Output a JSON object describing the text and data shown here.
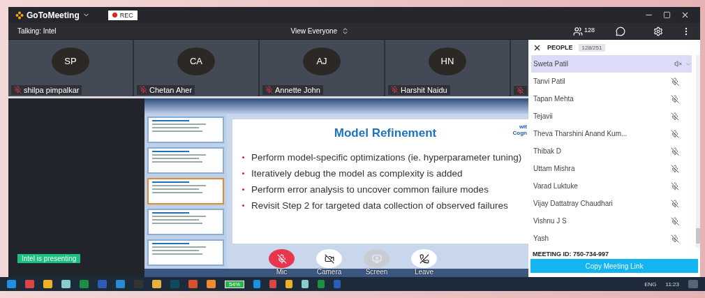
{
  "window": {
    "app_name": "GoToMeeting",
    "recording_label": "REC"
  },
  "toolbar": {
    "talking": "Talking: Intel",
    "view": "View Everyone",
    "people_count": "128"
  },
  "tiles": [
    {
      "initials": "SP",
      "name": "shilpa pimpalkar",
      "muted": true
    },
    {
      "initials": "CA",
      "name": "Chetan Aher",
      "muted": true
    },
    {
      "initials": "AJ",
      "name": "Annette John",
      "muted": true
    },
    {
      "initials": "HN",
      "name": "Harshit Naidu",
      "muted": true
    },
    {
      "muted": true
    }
  ],
  "presentation": {
    "presenter_badge": "Intel is presenting",
    "thumbnails": [
      {
        "selected": false
      },
      {
        "selected": false
      },
      {
        "selected": true
      },
      {
        "selected": false
      },
      {
        "selected": false
      }
    ],
    "slide": {
      "title": "Model Refinement",
      "logo_text": [
        "wit",
        "Cogn"
      ],
      "bullets": [
        "Perform model-specific optimizations (ie. hyperparameter tuning)",
        "Iteratively debug the model as complexity is added",
        "Perform error analysis to uncover common failure modes",
        "Revisit Step 2 for targeted data collection of observed failures"
      ]
    }
  },
  "controls": [
    {
      "label": "Mic",
      "kind": "mic",
      "on": false,
      "disabled": false
    },
    {
      "label": "Camera",
      "kind": "camera",
      "on": false,
      "disabled": false
    },
    {
      "label": "Screen",
      "kind": "screen",
      "on": false,
      "disabled": true
    },
    {
      "label": "Leave",
      "kind": "leave",
      "disabled": false
    }
  ],
  "people": {
    "title": "PEOPLE",
    "count": "128/251",
    "members": [
      {
        "name": "Sweta Patil",
        "selected": true,
        "kind": "speaker",
        "muted": true
      },
      {
        "name": "Tanvi Patil",
        "selected": false,
        "kind": "mic",
        "muted": true
      },
      {
        "name": "Tapan Mehta",
        "selected": false,
        "kind": "mic",
        "muted": true
      },
      {
        "name": "Tejavii",
        "selected": false,
        "kind": "mic",
        "muted": true
      },
      {
        "name": "Theva Tharshini Anand Kum...",
        "selected": false,
        "kind": "mic",
        "muted": true
      },
      {
        "name": "Thibak D",
        "selected": false,
        "kind": "mic",
        "muted": true
      },
      {
        "name": "Uttam Mishra",
        "selected": false,
        "kind": "mic",
        "muted": true
      },
      {
        "name": "Varad Luktuke",
        "selected": false,
        "kind": "mic",
        "muted": true
      },
      {
        "name": "Vijay Dattatray Chaudhari",
        "selected": false,
        "kind": "mic",
        "muted": true
      },
      {
        "name": "Vishnu J S",
        "selected": false,
        "kind": "mic",
        "muted": true
      },
      {
        "name": "Yash",
        "selected": false,
        "kind": "mic",
        "muted": true
      }
    ],
    "meeting_id": "MEETING ID: 750-734-997",
    "copy_button": "Copy Meeting Link"
  },
  "taskbar": {
    "battery": "54%",
    "language": "ENG",
    "time": "11:23"
  }
}
